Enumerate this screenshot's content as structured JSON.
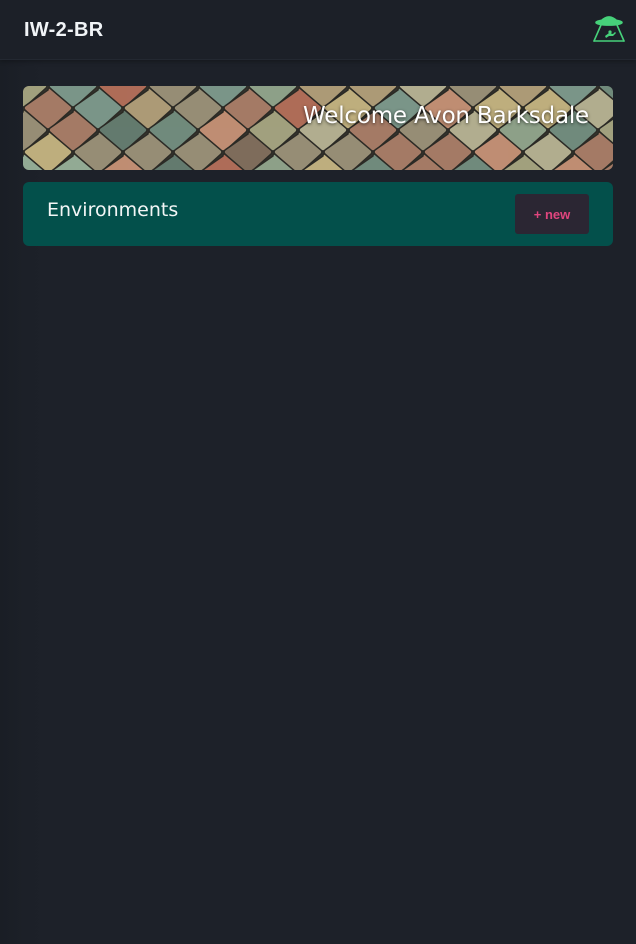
{
  "header": {
    "app_title": "IW-2-BR",
    "logo_icon": "ufo-abduction-icon",
    "logo_color": "#46d17a"
  },
  "banner": {
    "welcome_text": "Welcome Avon Barksdale"
  },
  "environments": {
    "title": "Environments",
    "new_button_label": "+ new",
    "panel_color": "#03504b",
    "button_text_color": "#e0457e"
  }
}
